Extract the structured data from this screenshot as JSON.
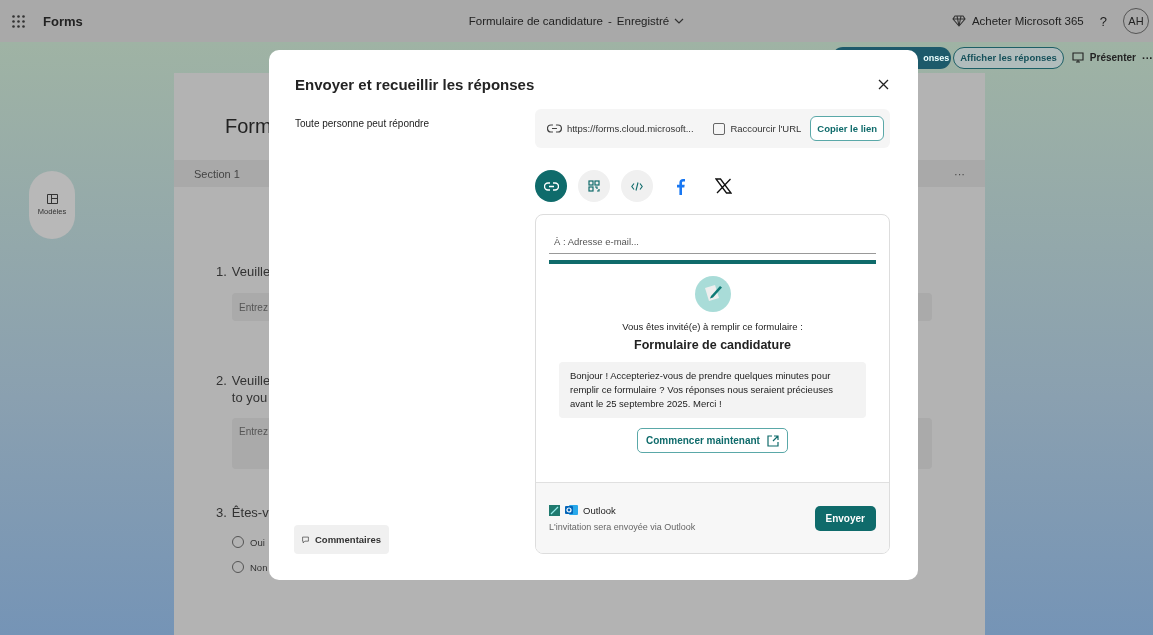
{
  "app_bar": {
    "app_name": "Forms",
    "document_title": "Formulaire de candidature",
    "separator": "-",
    "save_status": "Enregistré",
    "buy_label": "Acheter Microsoft 365",
    "help": "?",
    "avatar": "AH"
  },
  "toolbar": {
    "hidden_button_tail": "onses",
    "view_responses": "Afficher les réponses",
    "present": "Présenter",
    "more": "···"
  },
  "side_rail": {
    "templates_label": "Modèles"
  },
  "form_background": {
    "title": "Form",
    "section": "Section 1",
    "section_more": "···",
    "questions": [
      {
        "kind": "short",
        "number": "1.",
        "title_lines": [
          "Veuille"
        ],
        "placeholder": "Entrez"
      },
      {
        "kind": "long",
        "number": "2.",
        "title_lines": [
          "Veuille",
          "to you"
        ],
        "placeholder": "Entrez"
      },
      {
        "kind": "choice",
        "number": "3.",
        "title_lines": [
          "Êtes-v"
        ],
        "options": [
          {
            "label": "Oui",
            "selected": false
          },
          {
            "label": "Non",
            "selected": false
          }
        ]
      }
    ]
  },
  "dialog": {
    "title": "Envoyer et recueillir les réponses",
    "audience": "Toute personne peut répondre",
    "comments_button": "Commentaires",
    "link": {
      "url": "https://forms.cloud.microsoft...",
      "shorten_label": "Raccourcir l'URL",
      "shorten_checked": false,
      "copy_button": "Copier le lien"
    },
    "share_options": [
      {
        "kind": "link",
        "selected": true
      },
      {
        "kind": "qr",
        "selected": false
      },
      {
        "kind": "embed",
        "selected": false
      },
      {
        "kind": "facebook",
        "selected": false
      },
      {
        "kind": "x",
        "selected": false
      }
    ],
    "email": {
      "placeholder": "À : Adresse e-mail...",
      "invite_line": "Vous êtes invité(e) à remplir ce formulaire :",
      "form_title": "Formulaire de candidature",
      "message": "Bonjour ! Accepteriez-vous de prendre quelques minutes pour remplir ce formulaire ? Vos réponses nous seraient précieuses avant le 25 septembre 2025. Merci !",
      "start_button": "Commencer maintenant",
      "outlook_checked": true,
      "outlook_label": "Outlook",
      "note": "L'invitation sera envoyée via Outlook",
      "send_button": "Envoyer"
    }
  }
}
